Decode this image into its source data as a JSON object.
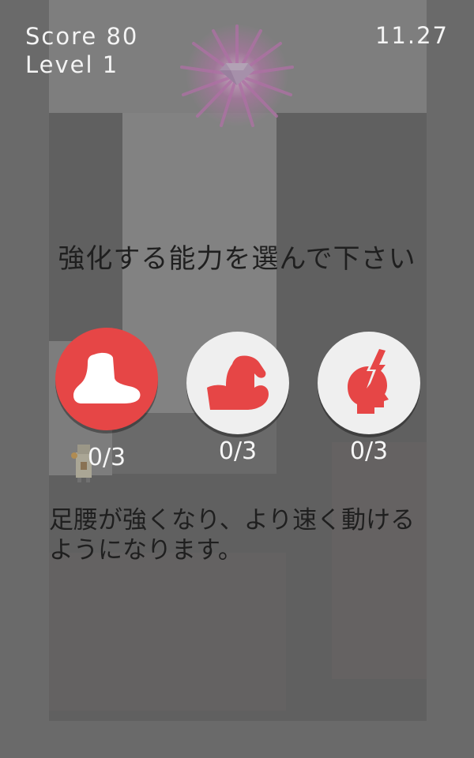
{
  "hud": {
    "score": "Score 80",
    "level": "Level 1",
    "time": "11.27"
  },
  "prompt": "強化する能力を選んで下さい",
  "skills": [
    {
      "icon": "foot-icon",
      "count": "0/3",
      "selected": true
    },
    {
      "icon": "muscle-arm-icon",
      "count": "0/3",
      "selected": false
    },
    {
      "icon": "head-lightning-icon",
      "count": "0/3",
      "selected": false
    }
  ],
  "description": "足腰が強くなり、より速く動けるようになります。",
  "colors": {
    "accent": "#e64646",
    "button": "#efefef",
    "overlay": "#6e6e6e"
  }
}
